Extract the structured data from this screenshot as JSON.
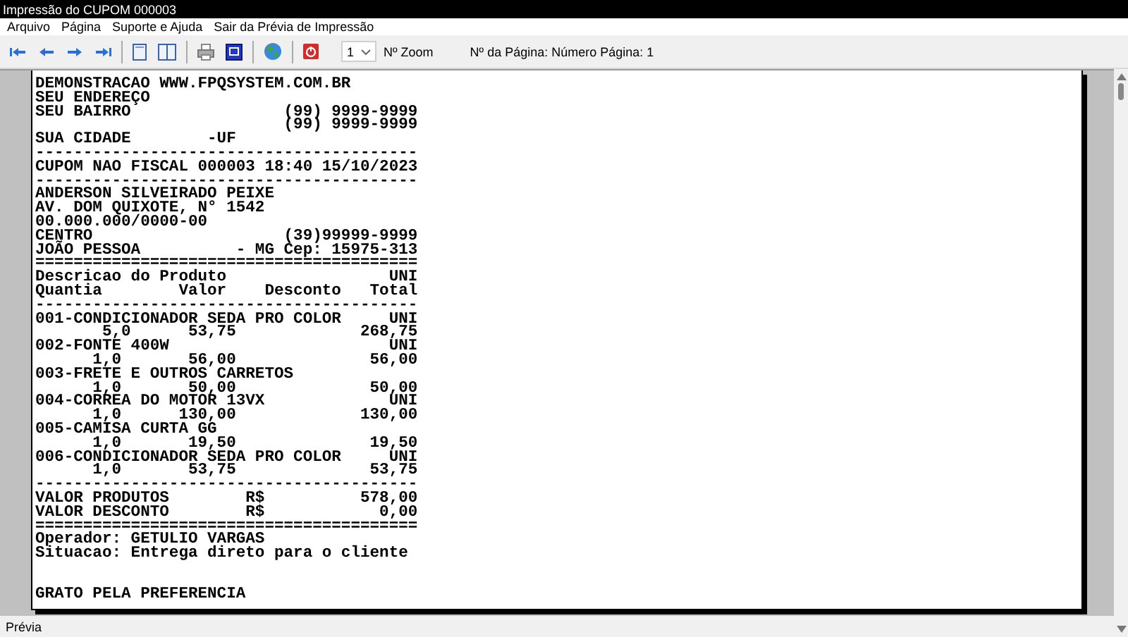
{
  "window": {
    "title": "Impressão do CUPOM 000003"
  },
  "menu": [
    "Arquivo",
    "Página",
    "Suporte e Ajuda",
    "Sair da Prévia de Impressão"
  ],
  "toolbar": {
    "tools": [
      {
        "kind": "first"
      },
      {
        "kind": "prev"
      },
      {
        "kind": "next"
      },
      {
        "kind": "last"
      },
      {
        "kind": "sep"
      },
      {
        "kind": "page"
      },
      {
        "kind": "twopage"
      },
      {
        "kind": "sep"
      },
      {
        "kind": "printer"
      },
      {
        "kind": "setup"
      },
      {
        "kind": "sep"
      },
      {
        "kind": "globe"
      },
      {
        "kind": "sep"
      },
      {
        "kind": "close"
      }
    ],
    "zoom_value": "1",
    "zoom_label": "Nº Zoom",
    "page_info": "Nº da Página: Número Página: 1"
  },
  "receipt": {
    "lines": [
      "DEMONSTRACAO WWW.FPQSYSTEM.COM.BR",
      "SEU ENDEREÇO",
      "SEU BAIRRO                (99) 9999-9999",
      "                          (99) 9999-9999",
      "SUA CIDADE        -UF",
      "----------------------------------------",
      "CUPOM NAO FISCAL 000003 18:40 15/10/2023",
      "----------------------------------------",
      "ANDERSON SILVEIRADO PEIXE",
      "AV. DOM QUIXOTE, N° 1542",
      "00.000.000/0000-00",
      "CENTRO                    (39)99999-9999",
      "JOÃO PESSOA          - MG Cep: 15975-313",
      "========================================",
      "Descricao do Produto                 UNI",
      "Quantia        Valor    Desconto   Total",
      "----------------------------------------",
      "001-CONDICIONADOR SEDA PRO COLOR     UNI",
      "       5,0      53,75             268,75",
      "002-FONTE 400W                       UNI",
      "      1,0       56,00              56,00",
      "003-FRETE E OUTROS CARRETOS",
      "      1,0       50,00              50,00",
      "004-CORREA DO MOTOR 13VX             UNI",
      "      1,0      130,00             130,00",
      "005-CAMISA CURTA GG",
      "      1,0       19,50              19,50",
      "006-CONDICIONADOR SEDA PRO COLOR     UNI",
      "      1,0       53,75              53,75",
      "----------------------------------------",
      "VALOR PRODUTOS        R$          578,00",
      "VALOR DESCONTO        R$            0,00",
      "========================================",
      "Operador: GETULIO VARGAS",
      "Situacao: Entrega direto para o cliente"
    ],
    "footer": "GRATO PELA PREFERENCIA"
  },
  "status_bar": "Prévia"
}
